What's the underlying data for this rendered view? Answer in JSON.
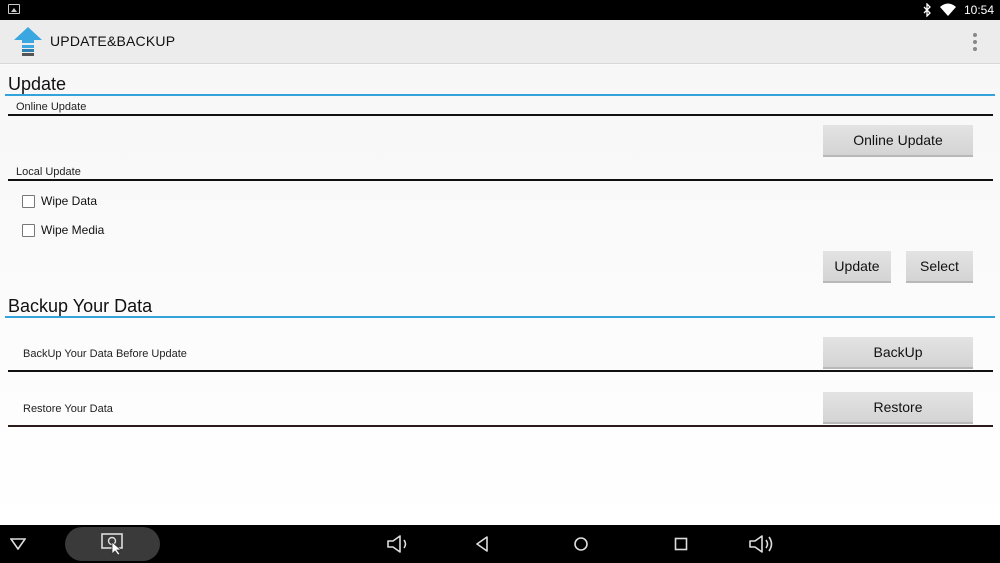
{
  "status_bar": {
    "time": "10:54",
    "icons": [
      "image-notification-icon",
      "bluetooth-icon",
      "wifi-icon"
    ]
  },
  "action_bar": {
    "title": "UPDATE&BACKUP",
    "app_icon": "upload-arrow-icon",
    "menu_icon": "overflow-menu-icon"
  },
  "update_section": {
    "title": "Update",
    "online_update": {
      "label": "Online Update",
      "button": "Online Update"
    },
    "local_update": {
      "label": "Local Update",
      "options": [
        {
          "label": "Wipe Data",
          "checked": false
        },
        {
          "label": "Wipe Media",
          "checked": false
        }
      ],
      "update_button": "Update",
      "select_button": "Select"
    }
  },
  "backup_section": {
    "title": "Backup Your Data",
    "rows": [
      {
        "label": "BackUp Your Data Before Update",
        "button": "BackUp"
      },
      {
        "label": "Restore Your Data",
        "button": "Restore"
      }
    ]
  },
  "nav_bar": {
    "icons": [
      "hide-nav-icon",
      "screenshot-icon",
      "volume-down-icon",
      "back-icon",
      "home-icon",
      "recents-icon",
      "volume-up-icon"
    ]
  },
  "colors": {
    "accent_line": "#33a3dc",
    "action_bar_bg": "#ececec",
    "button_bg": "#dcdcdc"
  }
}
